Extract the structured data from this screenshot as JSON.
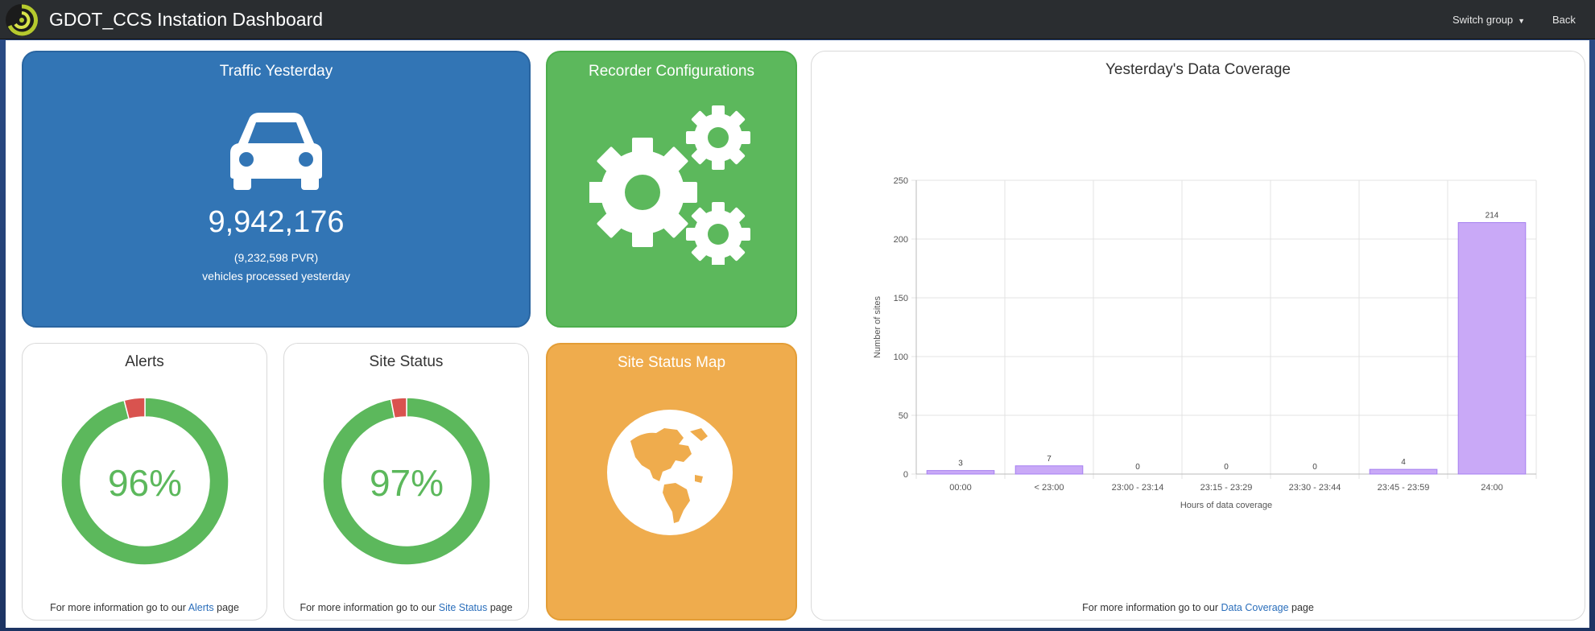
{
  "app": {
    "title": "GDOT_CCS Instation Dashboard",
    "switch_group": "Switch group",
    "back": "Back"
  },
  "traffic": {
    "title": "Traffic Yesterday",
    "count": "9,942,176",
    "pvr": "(9,232,598 PVR)",
    "caption": "vehicles processed yesterday"
  },
  "recorder": {
    "title": "Recorder Configurations"
  },
  "alerts": {
    "title": "Alerts",
    "percent": "96%",
    "ok_fraction": 0.96,
    "footer_prefix": "For more information go to our",
    "footer_link": "Alerts",
    "footer_suffix": "page"
  },
  "site_status": {
    "title": "Site Status",
    "percent": "97%",
    "ok_fraction": 0.97,
    "footer_prefix": "For more information go to our",
    "footer_link": "Site Status",
    "footer_suffix": "page"
  },
  "map": {
    "title": "Site Status Map"
  },
  "coverage": {
    "title": "Yesterday's Data Coverage",
    "footer_prefix": "For more information go to our",
    "footer_link": "Data Coverage",
    "footer_suffix": "page"
  },
  "colors": {
    "blue_tile": "#3275b5",
    "green_tile": "#5cb85c",
    "orange_tile": "#efac4d",
    "donut_ok": "#5cb85c",
    "donut_bad": "#d9534f",
    "bar_fill": "#c9a9f7",
    "bar_stroke": "#a57ff0"
  },
  "chart_data": {
    "type": "bar",
    "title": "",
    "xlabel": "Hours of data coverage",
    "ylabel": "Number of sites",
    "categories": [
      "00:00",
      "< 23:00",
      "23:00 - 23:14",
      "23:15 - 23:29",
      "23:30 - 23:44",
      "23:45 - 23:59",
      "24:00"
    ],
    "values": [
      3,
      7,
      0,
      0,
      0,
      4,
      214
    ],
    "ylim": [
      0,
      250
    ],
    "yticks": [
      0,
      50,
      100,
      150,
      200,
      250
    ],
    "grid": true,
    "data_labels": true
  }
}
